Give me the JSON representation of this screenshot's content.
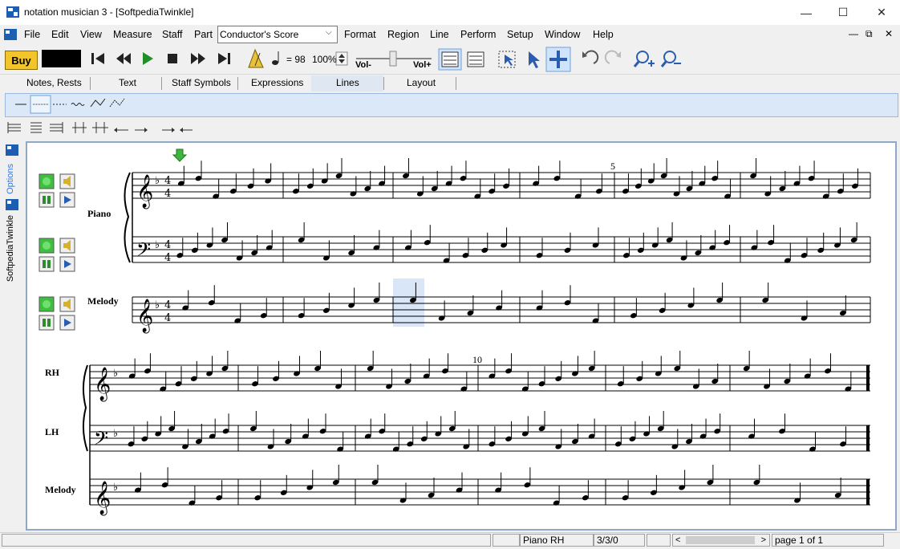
{
  "window": {
    "title": "notation musician 3 - [SoftpediaTwinkle]",
    "minimize_icon": "minimize-icon",
    "maximize_icon": "maximize-icon",
    "close_icon": "close-icon"
  },
  "menu": {
    "items": [
      "File",
      "Edit",
      "View",
      "Measure",
      "Staff",
      "Part",
      "Format",
      "Region",
      "Line",
      "Perform",
      "Setup",
      "Window",
      "Help"
    ],
    "score_view": "Conductor's Score"
  },
  "toolbar": {
    "buy_label": "Buy",
    "tempo": "= 98",
    "zoom": "100%",
    "vol_minus": "Vol-",
    "vol_plus": "Vol+"
  },
  "tabs": [
    "Notes, Rests",
    "Text",
    "Staff Symbols",
    "Expressions",
    "Lines",
    "Layout"
  ],
  "side_tabs": {
    "options": "Options",
    "file": "SoftpediaTwinkle"
  },
  "score": {
    "system1": {
      "staff_labels": [
        "Piano",
        "Melody"
      ],
      "measure_number": "5"
    },
    "system2": {
      "staff_labels": [
        "RH",
        "LH",
        "Melody"
      ],
      "measure_number": "10"
    }
  },
  "status": {
    "part": "Piano RH",
    "position": "3/3/0",
    "page": "page 1 of 1"
  },
  "colors": {
    "accent": "#3b78d8",
    "buy": "#f3c52a",
    "palette": "#dbe8f8",
    "canvas_border": "#90a8c8"
  }
}
